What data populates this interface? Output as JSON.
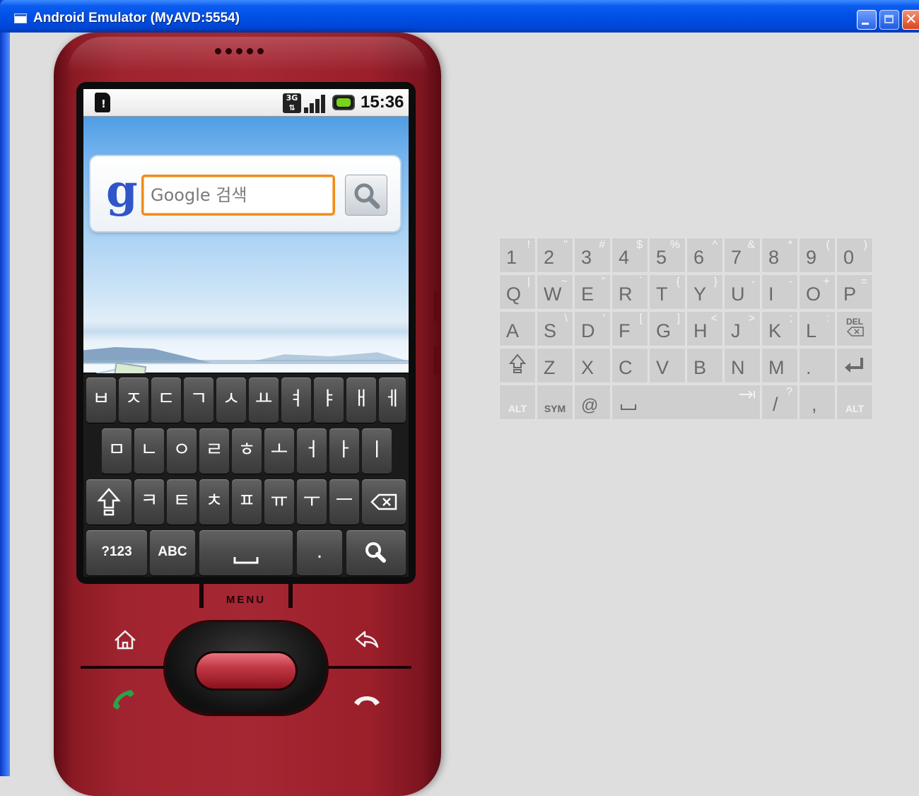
{
  "window": {
    "title": "Android Emulator (MyAVD:5554)"
  },
  "status_bar": {
    "time": "15:36",
    "network_badge": "3G",
    "icons": [
      "sim-alert-icon",
      "3g-icon",
      "signal-strength-icon",
      "battery-charging-icon"
    ]
  },
  "search_widget": {
    "logo_letter": "g",
    "placeholder": "Google 검색",
    "button_icon": "magnifier-icon"
  },
  "soft_keyboard": {
    "row1": [
      "ㅂ",
      "ㅈ",
      "ㄷ",
      "ㄱ",
      "ㅅ",
      "ㅛ",
      "ㅕ",
      "ㅑ",
      "ㅐ",
      "ㅔ"
    ],
    "row2": [
      "ㅁ",
      "ㄴ",
      "ㅇ",
      "ㄹ",
      "ㅎ",
      "ㅗ",
      "ㅓ",
      "ㅏ",
      "ㅣ"
    ],
    "row3": [
      "ㅋ",
      "ㅌ",
      "ㅊ",
      "ㅍ",
      "ㅠ",
      "ㅜ",
      "ㅡ"
    ],
    "shift_icon": "shift-icon",
    "backspace_icon": "backspace-icon",
    "symbols_label": "?123",
    "abc_label": "ABC",
    "space_icon": "space-icon",
    "period_label": ".",
    "search_icon": "search-icon"
  },
  "phone_buttons": {
    "menu_label": "MENU",
    "home_icon": "home-icon",
    "back_icon": "back-icon",
    "call_icon": "call-icon",
    "end_call_icon": "end-call-icon"
  },
  "hardware_keyboard": {
    "row1": [
      {
        "main": "1",
        "sub": "!"
      },
      {
        "main": "2",
        "sub": "\""
      },
      {
        "main": "3",
        "sub": "#"
      },
      {
        "main": "4",
        "sub": "$"
      },
      {
        "main": "5",
        "sub": "%"
      },
      {
        "main": "6",
        "sub": "^"
      },
      {
        "main": "7",
        "sub": "&"
      },
      {
        "main": "8",
        "sub": "*"
      },
      {
        "main": "9",
        "sub": "("
      },
      {
        "main": "0",
        "sub": ")"
      }
    ],
    "row2": [
      {
        "main": "Q",
        "sub": "|"
      },
      {
        "main": "W",
        "sub": "~"
      },
      {
        "main": "E",
        "sub": "\""
      },
      {
        "main": "R",
        "sub": "`"
      },
      {
        "main": "T",
        "sub": "{"
      },
      {
        "main": "Y",
        "sub": "}"
      },
      {
        "main": "U",
        "sub": "-"
      },
      {
        "main": "I",
        "sub": "-"
      },
      {
        "main": "O",
        "sub": "+"
      },
      {
        "main": "P",
        "sub": "="
      }
    ],
    "row3": [
      {
        "main": "A",
        "sub": ""
      },
      {
        "main": "S",
        "sub": "\\"
      },
      {
        "main": "D",
        "sub": "'"
      },
      {
        "main": "F",
        "sub": "["
      },
      {
        "main": "G",
        "sub": "]"
      },
      {
        "main": "H",
        "sub": "<"
      },
      {
        "main": "J",
        "sub": ">"
      },
      {
        "main": "K",
        "sub": ";"
      },
      {
        "main": "L",
        "sub": ":"
      }
    ],
    "del_label": "DEL",
    "row4": [
      "Z",
      "X",
      "C",
      "V",
      "B",
      "N",
      "M",
      "."
    ],
    "shift_icon": "shift-icon",
    "enter_icon": "enter-icon",
    "alt_label": "ALT",
    "sym_label": "SYM",
    "at_label": "@",
    "space_icon": "space-icon",
    "tab_icon": "tab-arrow-icon",
    "slash_label": "/",
    "slash_sub": "?",
    "comma_label": ","
  }
}
